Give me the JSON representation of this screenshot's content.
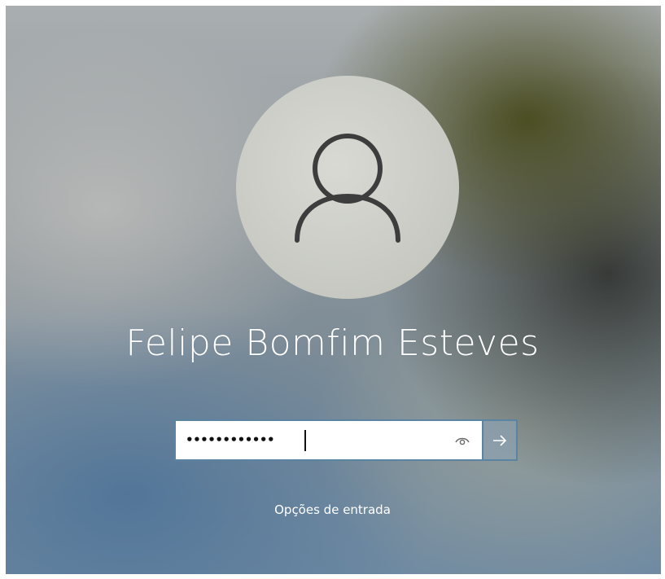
{
  "lock_screen": {
    "avatar_icon": "person-icon",
    "user_name": "Felipe Bomfim Esteves",
    "password": {
      "masked_value": "••••••••••••",
      "reveal_icon": "eye-icon"
    },
    "submit_icon": "arrow-right-icon",
    "sign_in_options_label": "Opções de entrada"
  },
  "colors": {
    "field_border": "#5b84a3",
    "text": "#ffffff"
  }
}
